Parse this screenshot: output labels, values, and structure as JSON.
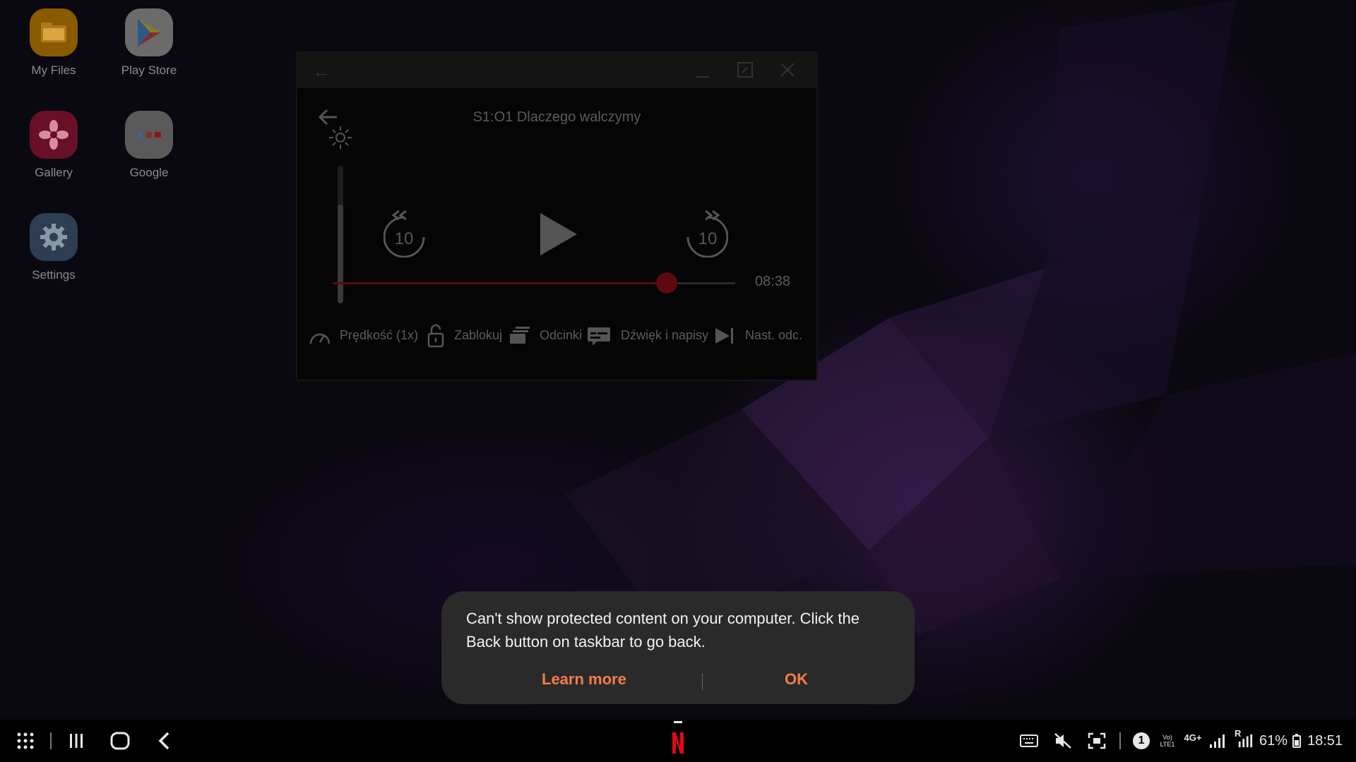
{
  "desktop": {
    "icons": [
      {
        "label": "My Files",
        "icon": "folder-icon",
        "color": "#f4b400"
      },
      {
        "label": "Play Store",
        "icon": "play-store-icon",
        "color": "#eeeeee"
      },
      {
        "label": "Gallery",
        "icon": "flower-icon",
        "color": "#d6204e"
      },
      {
        "label": "Google",
        "icon": "google-folder-icon",
        "color": "#e6e6e6"
      },
      {
        "label": "Settings",
        "icon": "gear-icon",
        "color": "#5e7a9a"
      }
    ]
  },
  "player": {
    "episode_title": "S1:O1 Dlaczego walczymy",
    "skip_back_seconds": "10",
    "skip_forward_seconds": "10",
    "time_remaining": "08:38",
    "progress_fraction": 0.83,
    "brightness_fraction": 0.72,
    "controls": {
      "speed": "Prędkość (1x)",
      "lock": "Zablokuj",
      "episodes": "Odcinki",
      "audio_subtitles": "Dźwięk i napisy",
      "next_episode": "Nast. odc."
    },
    "accent_color": "#e50914"
  },
  "dialog": {
    "message": "Can't show protected content on your computer. Click the Back button on taskbar to go back.",
    "learn_more": "Learn more",
    "ok": "OK",
    "button_color": "#f57c4b"
  },
  "taskbar": {
    "battery": "61%",
    "time": "18:51",
    "network": "4G+",
    "volte": "Vo) LTE1",
    "sim_badge": "1",
    "roaming": "R"
  }
}
